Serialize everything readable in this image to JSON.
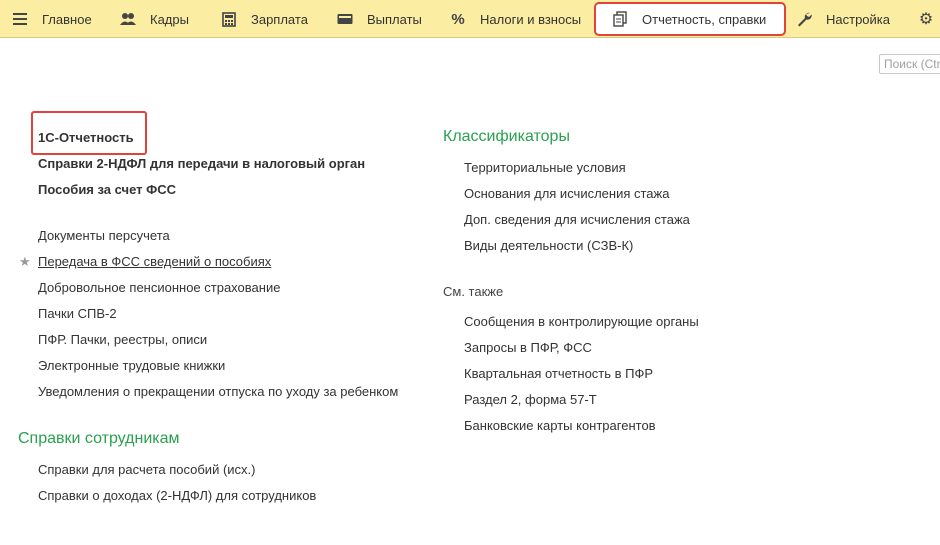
{
  "menu": {
    "items": [
      {
        "id": "main",
        "label": "Главное",
        "icon": "hamburger-icon"
      },
      {
        "id": "staff",
        "label": "Кадры",
        "icon": "people-icon"
      },
      {
        "id": "salary",
        "label": "Зарплата",
        "icon": "calculator-icon"
      },
      {
        "id": "payments",
        "label": "Выплаты",
        "icon": "wallet-icon"
      },
      {
        "id": "taxes",
        "label": "Налоги и взносы",
        "icon": "percent-icon"
      },
      {
        "id": "reports",
        "label": "Отчетность, справки",
        "icon": "documents-icon",
        "active": true
      },
      {
        "id": "settings",
        "label": "Настройка",
        "icon": "wrench-icon"
      }
    ],
    "gear_icon": "gear-icon"
  },
  "search": {
    "placeholder": "Поиск (Ctrl+F)"
  },
  "left": {
    "group1": [
      "1С-Отчетность",
      "Справки 2-НДФЛ для передачи в налоговый орган",
      "Пособия за счет ФСС"
    ],
    "group2": [
      "Документы персучета",
      "Передача в ФСС сведений о пособиях",
      "Добровольное пенсионное страхование",
      "Пачки СПВ-2",
      "ПФР. Пачки, реестры, описи",
      "Электронные трудовые книжки",
      "Уведомления о прекращении отпуска по уходу за ребенком"
    ],
    "employees_header": "Справки сотрудникам",
    "employees": [
      "Справки для расчета пособий (исх.)",
      "Справки о доходах (2-НДФЛ) для сотрудников"
    ]
  },
  "right": {
    "classifiers_header": "Классификаторы",
    "classifiers": [
      "Территориальные условия",
      "Основания для исчисления стажа",
      "Доп. сведения для исчисления стажа",
      "Виды деятельности (СЗВ-К)"
    ],
    "see_also_header": "См. также",
    "see_also": [
      "Сообщения в контролирующие органы",
      "Запросы в ПФР, ФСС",
      "Квартальная отчетность в ПФР",
      "Раздел 2, форма 57-Т",
      "Банковские карты контрагентов"
    ]
  },
  "colors": {
    "menubar": "#fbeda2",
    "highlight": "#e0433a",
    "section_header": "#2aa050"
  }
}
